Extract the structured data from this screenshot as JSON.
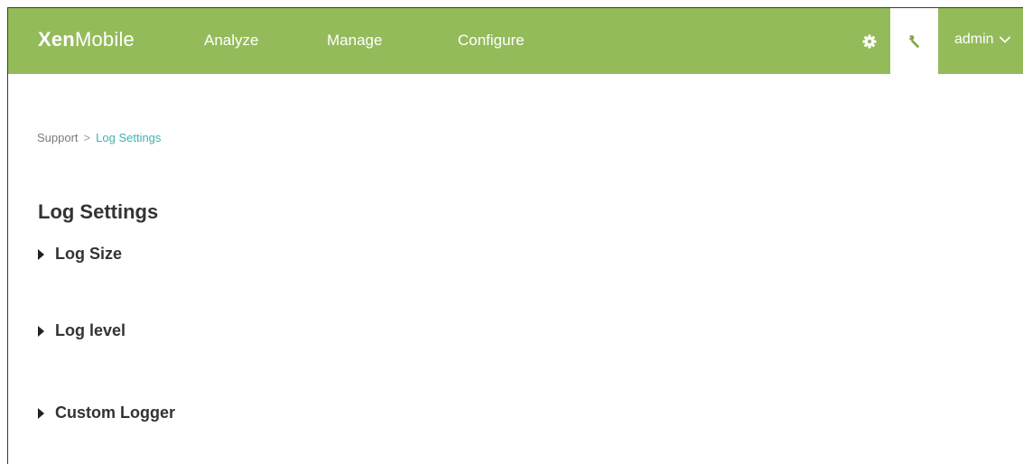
{
  "header": {
    "logo_bold": "Xen",
    "logo_light": "Mobile",
    "nav": [
      {
        "label": "Analyze"
      },
      {
        "label": "Manage"
      },
      {
        "label": "Configure"
      }
    ],
    "user_label": "admin",
    "bar_color": "#94bb5a"
  },
  "breadcrumb": {
    "parent": "Support",
    "separator": ">",
    "current": "Log Settings"
  },
  "page": {
    "title": "Log Settings",
    "sections": [
      {
        "label": "Log Size"
      },
      {
        "label": "Log level"
      },
      {
        "label": "Custom Logger"
      }
    ]
  },
  "icons": {
    "settings": "gear-icon",
    "support": "wrench-icon",
    "user_menu": "chevron-down-icon",
    "section_toggle": "caret-right-icon"
  }
}
